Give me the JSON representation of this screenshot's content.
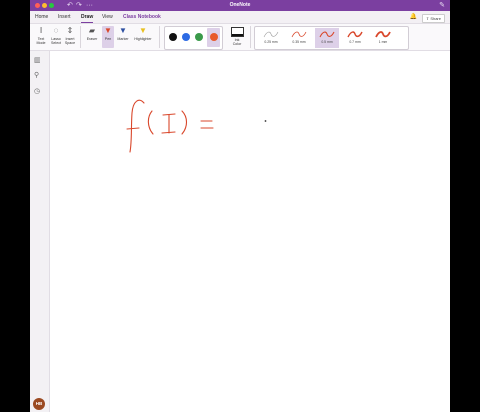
{
  "window": {
    "title": "OneNote"
  },
  "tabs": [
    "Home",
    "Insert",
    "Draw",
    "View",
    "Class Notebook"
  ],
  "share": {
    "label": "Share"
  },
  "ribbon": {
    "text_mode": [
      "Text",
      "Mode"
    ],
    "lasso_select": [
      "Lasso",
      "Select"
    ],
    "insert_space": [
      "Insert",
      "Space"
    ],
    "eraser": "Eraser",
    "pen": "Pen",
    "marker": "Marker",
    "highlighter": "Highlighter",
    "ink_color": [
      "Ink",
      "Color"
    ],
    "swatches": [
      "#111111",
      "#2D6BE4",
      "#3A9A4A",
      "#E85A2A"
    ],
    "selected_swatch": 3,
    "thickness": [
      "0.25 mm",
      "0.35 mm",
      "0.5 mm",
      "0.7 mm",
      "1 mm"
    ],
    "selected_thickness": 2,
    "accent": "#7B3FA0",
    "ink_stroke_color": "#D9472B"
  },
  "nav": {
    "avatar": "HB"
  }
}
